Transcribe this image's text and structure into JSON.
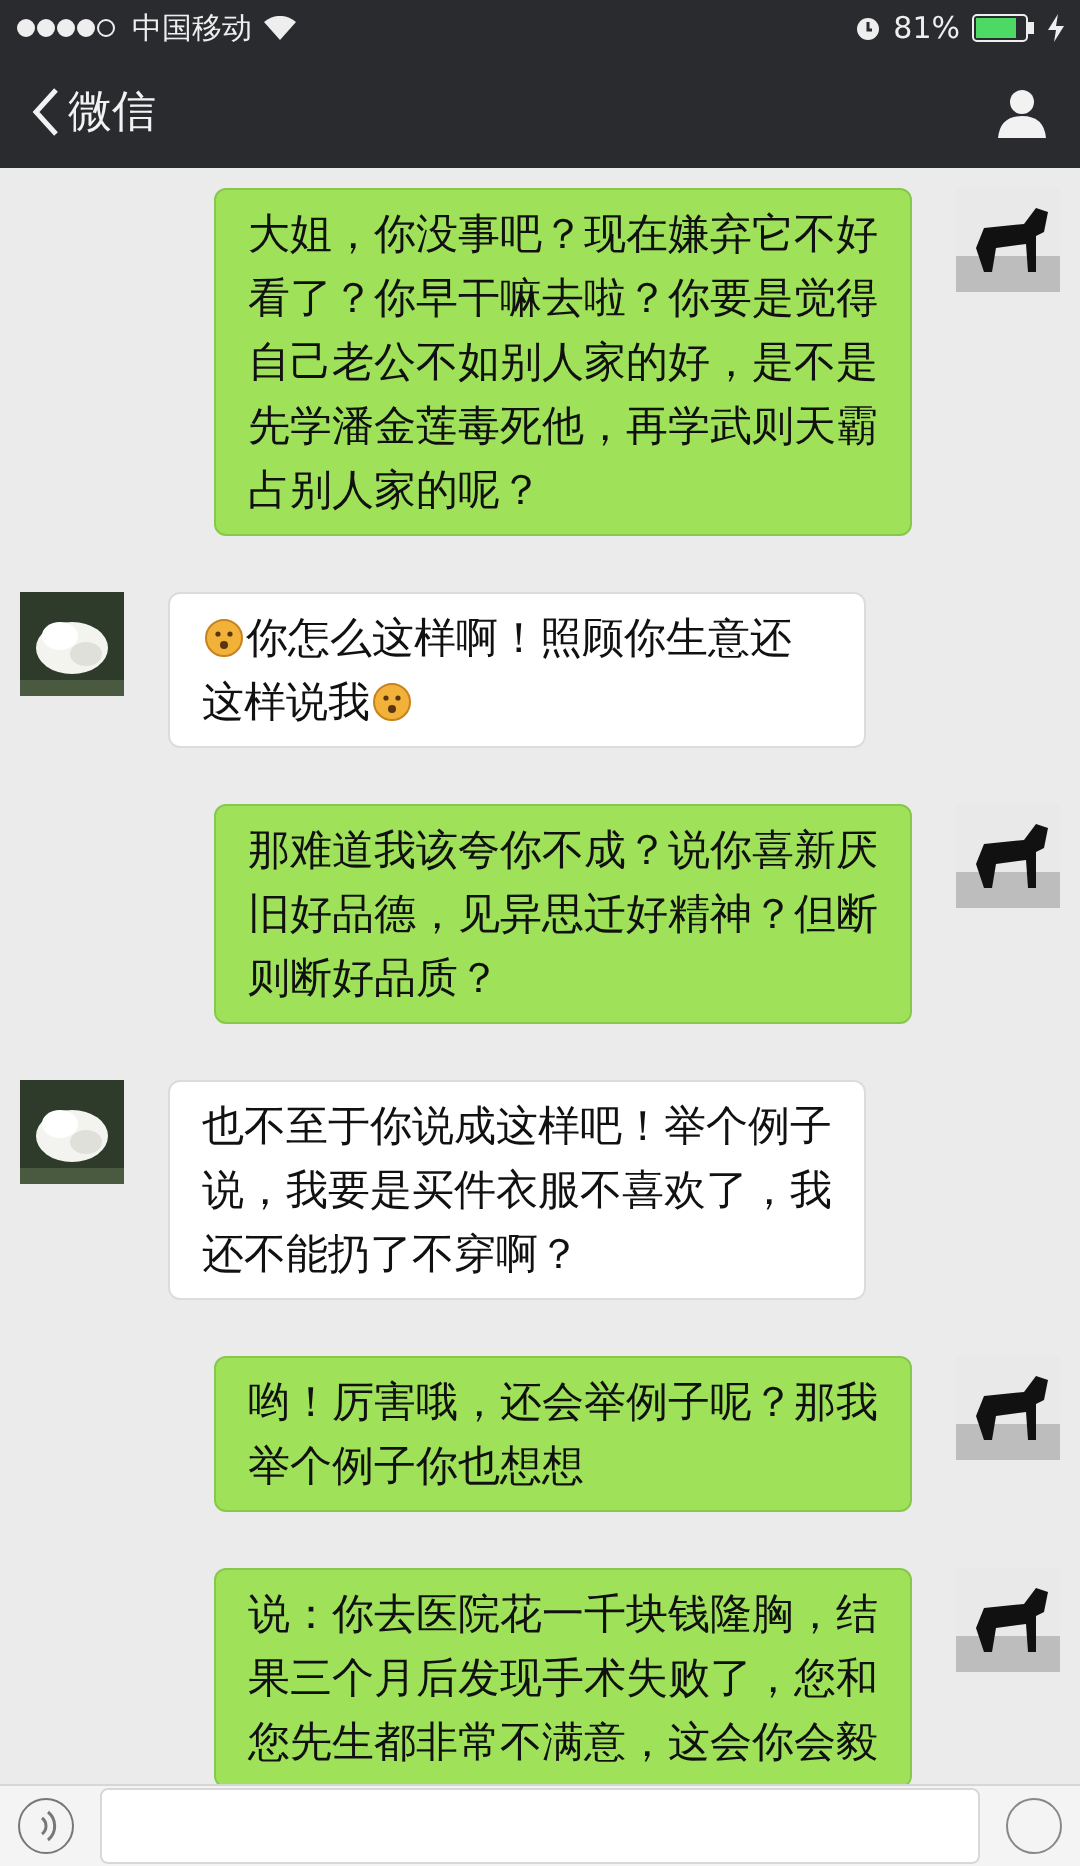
{
  "status_bar": {
    "carrier": "中国移动",
    "battery_text": "81%"
  },
  "nav": {
    "back_label": "微信"
  },
  "messages": [
    {
      "outgoing": true,
      "parts": [
        {
          "kind": "text",
          "text": "大姐，你没事吧？现在嫌弃它不好看了？你早干嘛去啦？你要是觉得自己老公不如别人家的好，是不是先学潘金莲毒死他，再学武则天霸占别人家的呢？"
        }
      ]
    },
    {
      "outgoing": false,
      "parts": [
        {
          "kind": "emoji"
        },
        {
          "kind": "text",
          "text": "你怎么这样啊！照顾你生意还这样说我"
        },
        {
          "kind": "emoji"
        }
      ]
    },
    {
      "outgoing": true,
      "parts": [
        {
          "kind": "text",
          "text": "那难道我该夸你不成？说你喜新厌旧好品德，见异思迁好精神？但断则断好品质？"
        }
      ]
    },
    {
      "outgoing": false,
      "parts": [
        {
          "kind": "text",
          "text": "也不至于你说成这样吧！举个例子说，我要是买件衣服不喜欢了，我还不能扔了不穿啊？"
        }
      ]
    },
    {
      "outgoing": true,
      "parts": [
        {
          "kind": "text",
          "text": "哟！厉害哦，还会举例子呢？那我举个例子你也想想"
        }
      ]
    },
    {
      "outgoing": true,
      "parts": [
        {
          "kind": "text",
          "text": "说：你去医院花一千块钱隆胸，结果三个月后发现手术失败了，您和您先生都非常不满意，这会你会毅"
        }
      ]
    }
  ]
}
